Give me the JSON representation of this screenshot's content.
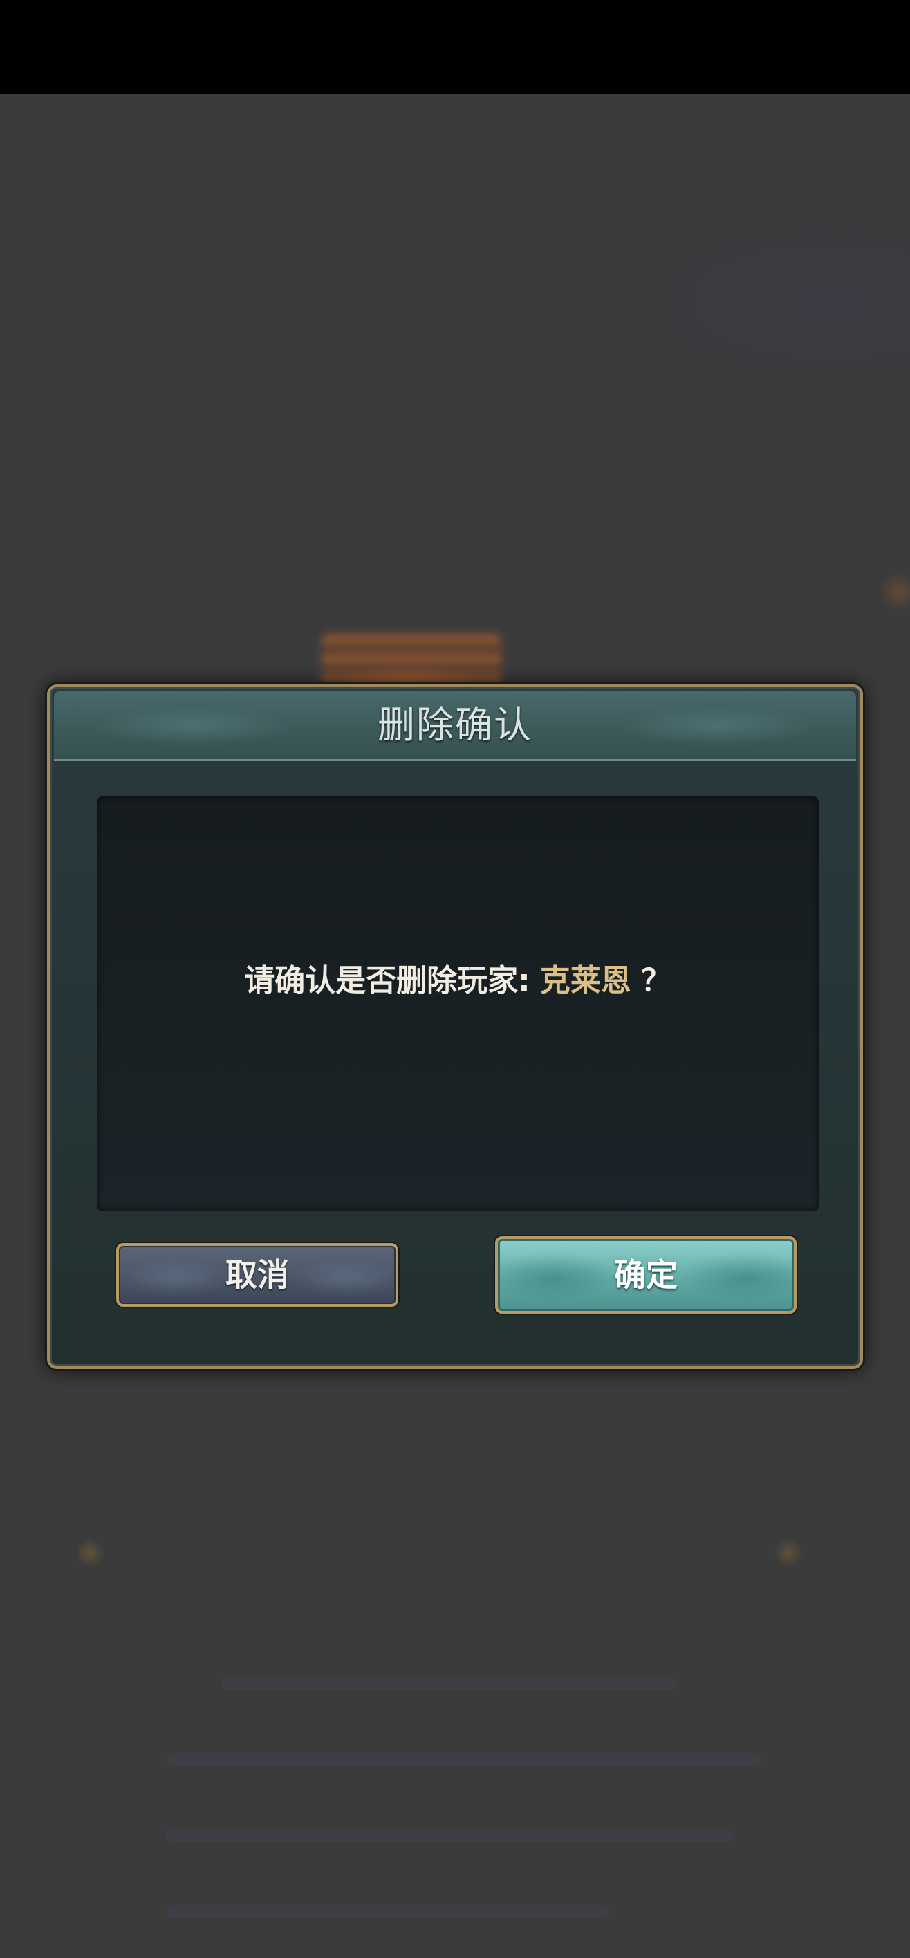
{
  "dialog": {
    "title": "删除确认",
    "message_prefix": "请确认是否删除玩家:",
    "player_name": "克莱恩",
    "message_suffix": "？",
    "cancel_label": "取消",
    "confirm_label": "确定"
  },
  "colors": {
    "player_name": "#dcbf85",
    "message_text": "#f1ede2",
    "confirm_button": "#5fa9a4",
    "cancel_button": "#4a5566",
    "frame_gold": "#a08a5c"
  }
}
